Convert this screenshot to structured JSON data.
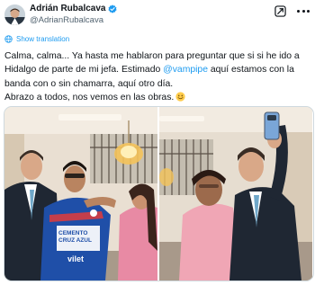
{
  "author": {
    "display_name": "Adrián Rubalcava",
    "handle": "@AdrianRubalcava",
    "verified": true
  },
  "icons": {
    "verified": "verified-badge-icon",
    "grok": "grok-icon",
    "more": "more-options-icon",
    "translate": "globe-icon"
  },
  "translation": {
    "label": "Show translation"
  },
  "tweet": {
    "line1": "Calma, calma... Ya hasta me hablaron para preguntar que si si he ido a",
    "line2_pre": "Hidalgo de parte de mi jefa. Estimado ",
    "mention": "@vampipe",
    "line2_post": " aquí estamos con la",
    "line3": "banda con o sin chamarra, aquí otro día.",
    "line4": "Abrazo a todos, nos vemos en las obras.",
    "emoji": "smiling-face-emoji"
  },
  "photos": [
    {
      "alt": "photo-1",
      "jersey_text": "CEMENTO\nCRUZ AZUL\nvilet"
    },
    {
      "alt": "photo-2"
    }
  ],
  "colors": {
    "accent": "#1d9bf0",
    "text": "#0f1419",
    "secondary": "#536471"
  }
}
